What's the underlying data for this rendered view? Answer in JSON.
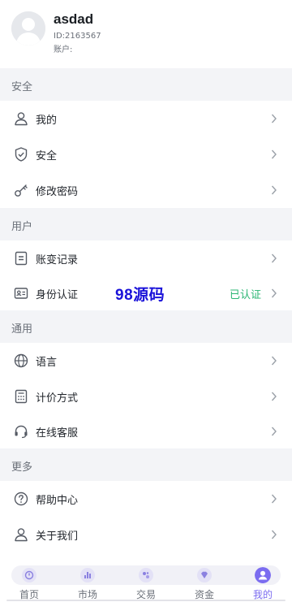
{
  "profile": {
    "name": "asdad",
    "id_text": "ID:2163567",
    "account_text": "账户:"
  },
  "sections": {
    "security": "安全",
    "user": "用户",
    "general": "通用",
    "more": "更多"
  },
  "rows": {
    "mine": "我的",
    "security": "安全",
    "password": "修改密码",
    "ledger": "账变记录",
    "identity": "身份认证",
    "identity_status": "已认证",
    "language": "语言",
    "pricing": "计价方式",
    "support": "在线客服",
    "help": "帮助中心",
    "about": "关于我们"
  },
  "watermark": "98源码",
  "tabs": {
    "home": "首页",
    "market": "市场",
    "trade": "交易",
    "funds": "资金",
    "mine": "我的"
  },
  "colors": {
    "accent": "#7b6cf0",
    "verified": "#2bb673",
    "watermark": "#1a12d9"
  }
}
